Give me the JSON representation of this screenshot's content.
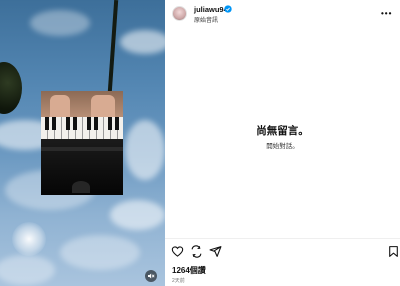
{
  "post": {
    "username": "juliawu94",
    "subtitle": "原始音訊",
    "views": "1264個讚",
    "time_ago": "2天前"
  },
  "comments": {
    "empty_title": "尚無留言。",
    "empty_subtitle": "開始對話。"
  },
  "icons": {
    "more": "more-options-icon",
    "verified": "verified-badge-icon",
    "like": "heart-icon",
    "comment": "comment-icon",
    "share": "share-icon",
    "save": "bookmark-icon",
    "mute": "muted-speaker-icon"
  },
  "colors": {
    "verified": "#0095f6",
    "text": "#111111",
    "muted_text": "#777777"
  }
}
